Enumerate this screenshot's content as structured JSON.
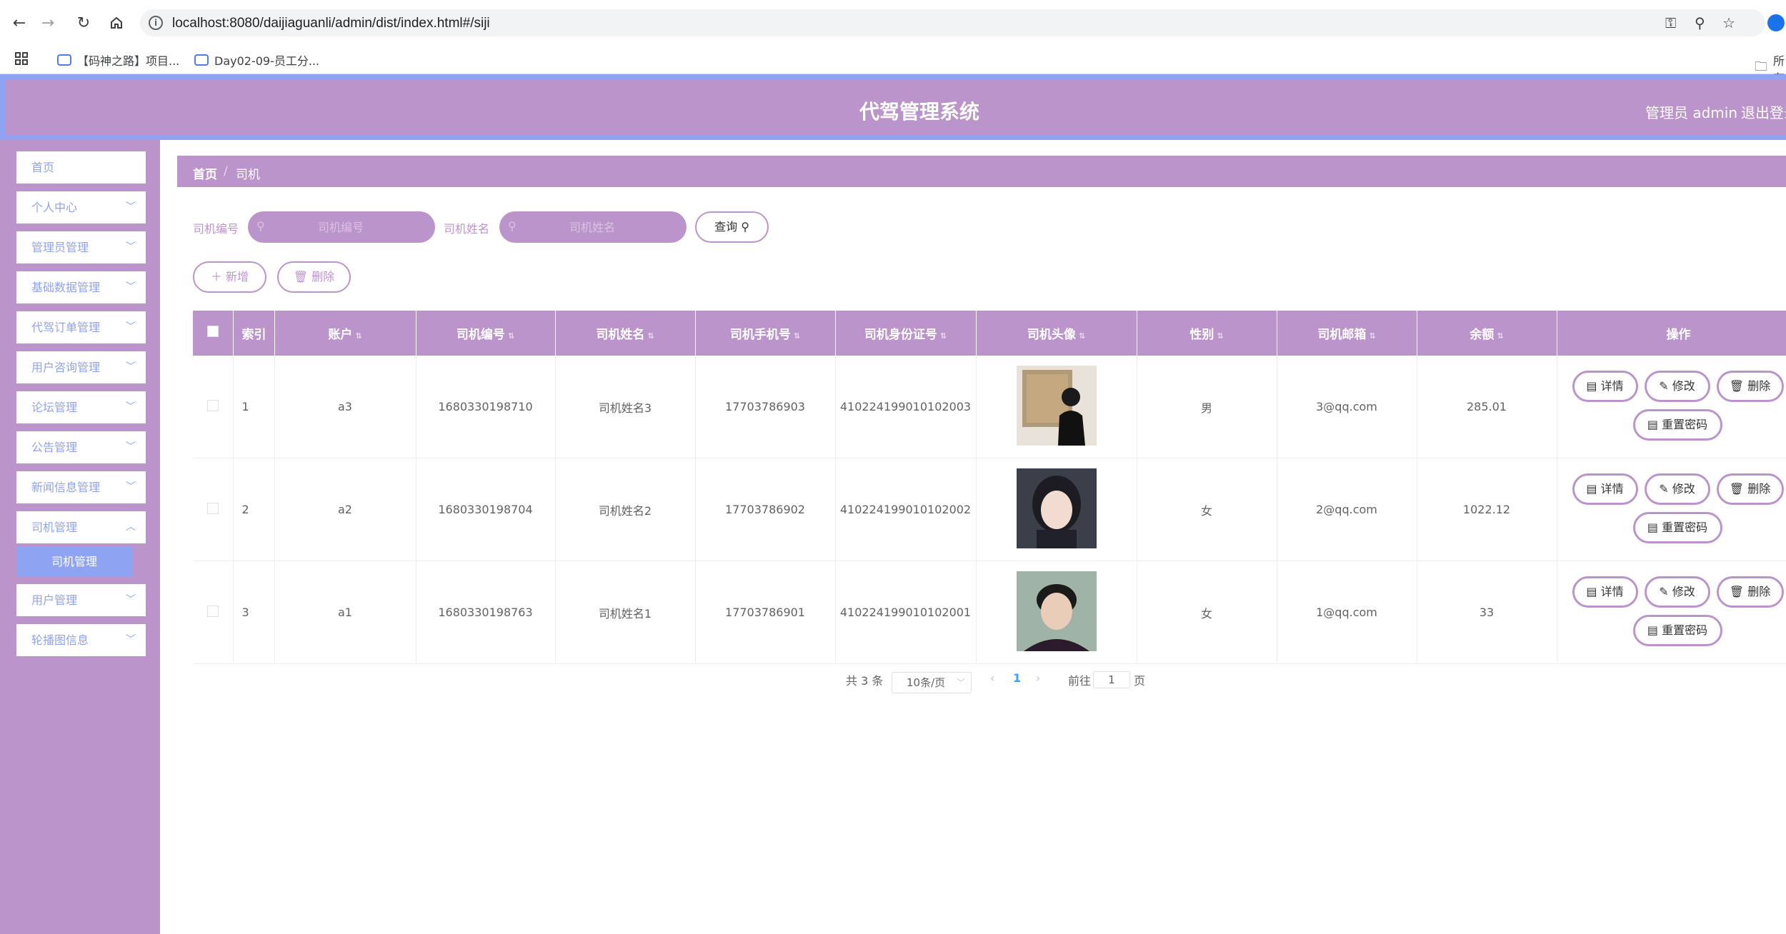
{
  "browser": {
    "url": "localhost:8080/daijiaguanli/admin/dist/index.html#/siji",
    "bookmarks": [
      "【码神之路】项目...",
      "Day02-09-员工分..."
    ],
    "bookmarks_right": "所有"
  },
  "header": {
    "title": "代驾管理系统",
    "admin": "管理员 admin",
    "logout": "退出登录"
  },
  "sidebar": {
    "items": [
      {
        "label": "首页",
        "has_arrow": false
      },
      {
        "label": "个人中心",
        "has_arrow": true
      },
      {
        "label": "管理员管理",
        "has_arrow": true
      },
      {
        "label": "基础数据管理",
        "has_arrow": true
      },
      {
        "label": "代驾订单管理",
        "has_arrow": true
      },
      {
        "label": "用户咨询管理",
        "has_arrow": true
      },
      {
        "label": "论坛管理",
        "has_arrow": true
      },
      {
        "label": "公告管理",
        "has_arrow": true
      },
      {
        "label": "新闻信息管理",
        "has_arrow": true
      },
      {
        "label": "司机管理",
        "has_arrow": true
      },
      {
        "label": "用户管理",
        "has_arrow": true
      },
      {
        "label": "轮播图信息",
        "has_arrow": true
      }
    ],
    "submenu_active": "司机管理"
  },
  "breadcrumb": {
    "home": "首页",
    "separator": "/",
    "current": "司机"
  },
  "search": {
    "driver_no_label": "司机编号",
    "driver_no_placeholder": "司机编号",
    "driver_name_label": "司机姓名",
    "driver_name_placeholder": "司机姓名",
    "query_button": "查询"
  },
  "actions": {
    "add": "新增",
    "delete": "删除"
  },
  "table": {
    "headers": [
      "索引",
      "账户",
      "司机编号",
      "司机姓名",
      "司机手机号",
      "司机身份证号",
      "司机头像",
      "性别",
      "司机邮箱",
      "余额",
      "操作"
    ],
    "rows": [
      {
        "index": "1",
        "account": "a3",
        "driver_no": "1680330198710",
        "name": "司机姓名3",
        "phone": "17703786903",
        "id_card": "410224199010102003",
        "gender": "男",
        "email": "3@qq.com",
        "balance": "285.01"
      },
      {
        "index": "2",
        "account": "a2",
        "driver_no": "1680330198704",
        "name": "司机姓名2",
        "phone": "17703786902",
        "id_card": "410224199010102002",
        "gender": "女",
        "email": "2@qq.com",
        "balance": "1022.12"
      },
      {
        "index": "3",
        "account": "a1",
        "driver_no": "1680330198763",
        "name": "司机姓名1",
        "phone": "17703786901",
        "id_card": "410224199010102001",
        "gender": "女",
        "email": "1@qq.com",
        "balance": "33"
      }
    ],
    "ops": {
      "detail": "详情",
      "edit": "修改",
      "delete": "删除",
      "reset_pwd": "重置密码"
    }
  },
  "pagination": {
    "total": "共 3 条",
    "page_size": "10条/页",
    "current_page": "1",
    "goto_prefix": "前往",
    "goto_value": "1",
    "goto_suffix": "页"
  },
  "colors": {
    "accent": "#bb94cb",
    "secondary": "#8ea4f2",
    "active_page": "#409eff"
  }
}
